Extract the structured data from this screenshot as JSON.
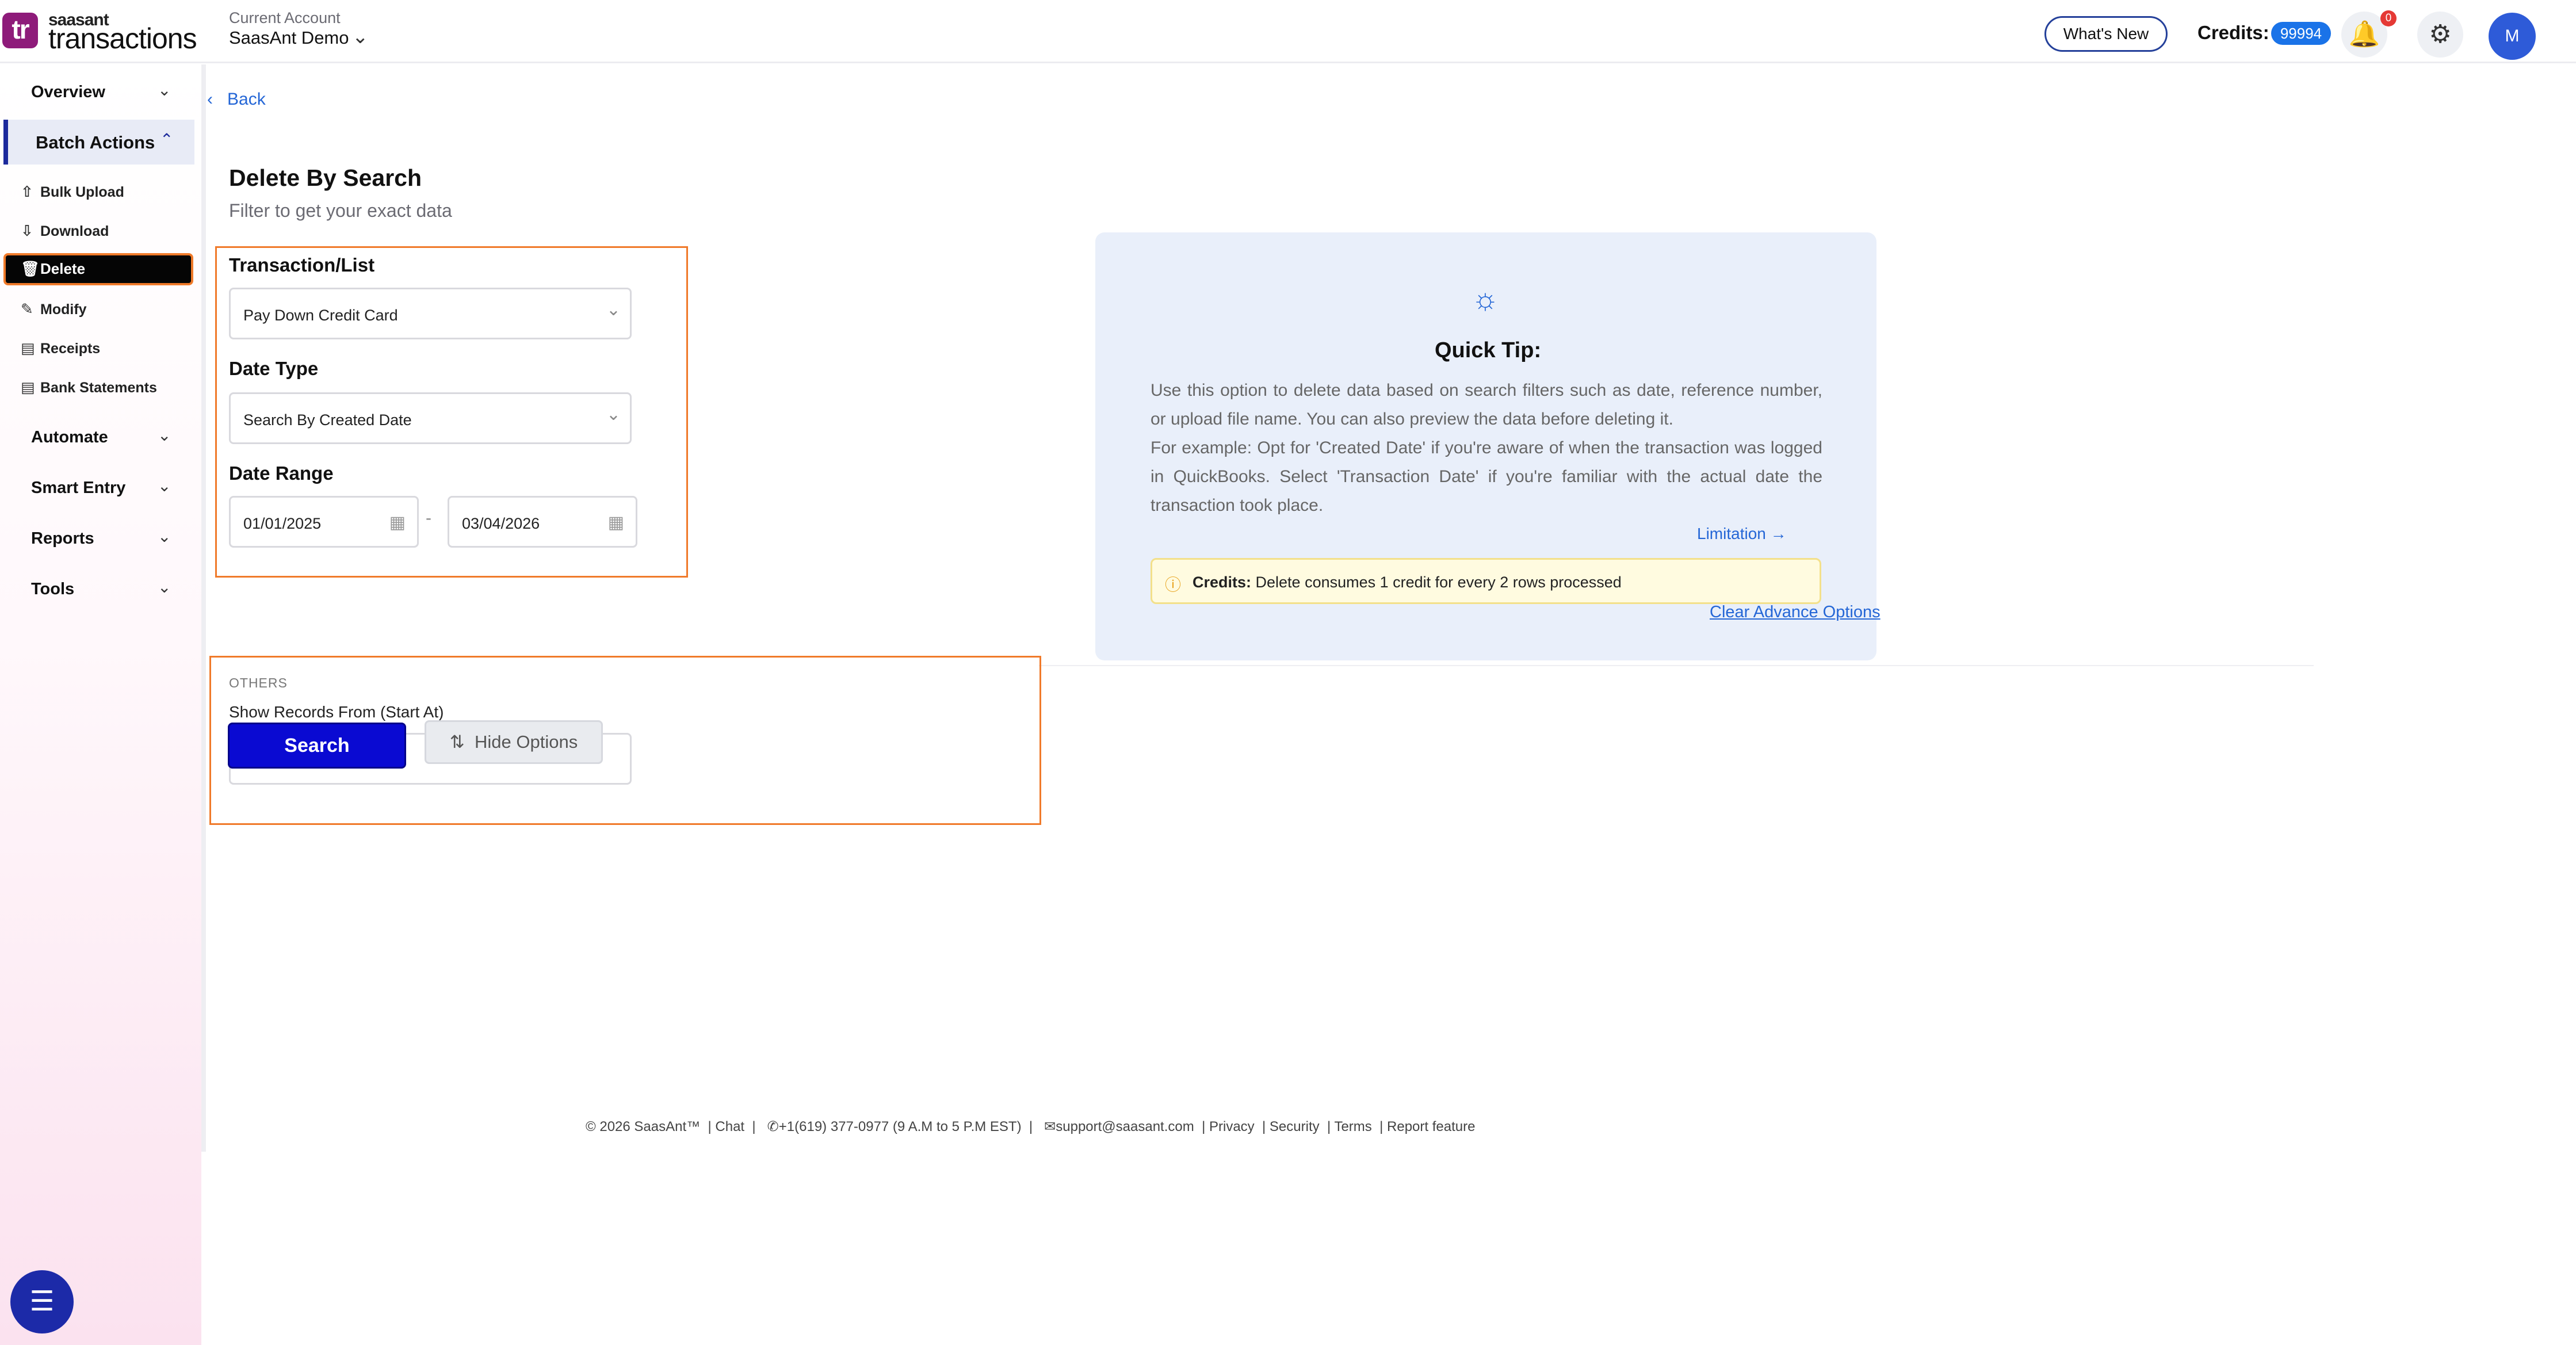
{
  "header": {
    "logo_mark": "tr",
    "logo_small": "saasant",
    "logo_big": "transactions",
    "account_label": "Current Account",
    "account_value": "SaasAnt Demo",
    "whats_new": "What's New",
    "credits_label": "Credits:",
    "credits_value": "99994",
    "notification_count": "0",
    "avatar_initial": "M",
    "icons": [
      "chevron-down-icon",
      "bell-icon",
      "gear-icon"
    ]
  },
  "sidebar": {
    "sections": [
      {
        "label": "Overview"
      },
      {
        "label": "Batch Actions"
      },
      {
        "label": "Automate"
      },
      {
        "label": "Smart Entry"
      },
      {
        "label": "Reports"
      },
      {
        "label": "Tools"
      }
    ],
    "batch_items": [
      {
        "label": "Bulk Upload",
        "icon": "upload-cloud-icon"
      },
      {
        "label": "Download",
        "icon": "download-cloud-icon"
      },
      {
        "label": "Delete",
        "icon": "trash-icon"
      },
      {
        "label": "Modify",
        "icon": "edit-file-icon"
      },
      {
        "label": "Receipts",
        "icon": "receipt-icon"
      },
      {
        "label": "Bank Statements",
        "icon": "document-icon"
      }
    ],
    "chat_icon": "chat-icon"
  },
  "main": {
    "back_label": "Back",
    "title": "Delete By Search",
    "subtitle": "Filter to get your exact data",
    "transaction_label": "Transaction/List",
    "transaction_value": "Pay Down Credit Card",
    "date_type_label": "Date Type",
    "date_type_value": "Search By Created Date",
    "date_range_label": "Date Range",
    "date_from": "01/01/2025",
    "date_to": "03/04/2026",
    "date_separator": "-",
    "others_label": "OTHERS",
    "show_records_label": "Show Records From (Start At)",
    "search_button": "Search",
    "hide_options_button": "Hide Options"
  },
  "tip": {
    "title": "Quick Tip:",
    "body_1": "Use this option to delete data based on search filters such as date, reference number, or upload file name. You can also preview the data before deleting it.",
    "body_2": "For example: Opt for 'Created Date' if you're aware of when the transaction was logged in QuickBooks. Select 'Transaction Date' if you're familiar with the actual date the transaction took place.",
    "limitation": "Limitation →",
    "credits_bold": "Credits:",
    "credits_text": " Delete consumes 1 credit for every 2 rows processed",
    "clear_advance": "Clear Advance Options"
  },
  "footer": {
    "copyright": "© 2026 SaasAnt™",
    "chat": "Chat",
    "phone": "+1(619) 377-0977 (9 A.M to 5 P.M EST)",
    "email": "support@saasant.com",
    "privacy": "Privacy",
    "security": "Security",
    "terms": "Terms",
    "report": "Report feature"
  },
  "colors": {
    "brand": "#8e1b7a",
    "primary": "#0a0ad2",
    "highlight_border": "#f07a2a",
    "link": "#2466d6",
    "tip_background": "#e9effa"
  }
}
